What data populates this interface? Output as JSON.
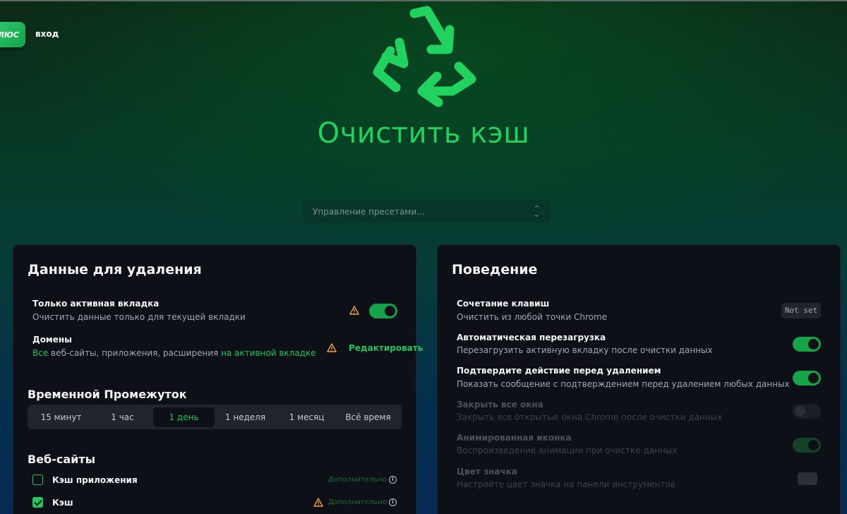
{
  "header": {
    "plus_label": "ЛЮС",
    "login_label": "вход",
    "app_title": "Очистить кэш",
    "preset_placeholder": "Управление пресетами..."
  },
  "data_card": {
    "title": "Данные для удаления",
    "active_tab": {
      "title": "Только активная вкладка",
      "desc": "Очистить данные только для текущей вкладки",
      "enabled": true
    },
    "domains": {
      "title": "Домены",
      "desc_all": "Все",
      "desc_middle": " веб-сайты, приложения, расширения ",
      "desc_scope": "на активной вкладке",
      "edit_label": "Редактировать"
    },
    "time_range": {
      "title": "Временной Промежуток",
      "options": [
        "15 минут",
        "1 час",
        "1 день",
        "1 неделя",
        "1 месяц",
        "Всё время"
      ],
      "selected": "1 день"
    },
    "websites": {
      "title": "Веб-сайты",
      "items": [
        {
          "label": "Кэш приложения",
          "checked": false,
          "more": "Дополнительно"
        },
        {
          "label": "Кэш",
          "checked": true,
          "more": "Дополнительно"
        }
      ]
    }
  },
  "behavior_card": {
    "title": "Поведение",
    "shortcut": {
      "title": "Сочетание клавиш",
      "desc": "Очистить из любой точки Chrome",
      "value": "Not set"
    },
    "auto_reload": {
      "title": "Автоматическая перезагрузка",
      "desc": "Перезагрузить активную вкладку после очистки данных",
      "enabled": true
    },
    "confirm": {
      "title": "Подтвердите действие перед удалением",
      "desc": "Показать сообщение с подтверждением перед удалением любых данных",
      "enabled": true
    },
    "close_windows": {
      "title": "Закрыть все окна",
      "desc": "Закрыть все открытые окна Chrome после очистки данных",
      "enabled": false
    },
    "animated_icon": {
      "title": "Анимированная иконка",
      "desc": "Воспроизведение анимации при очистке данных",
      "enabled": true
    },
    "icon_color": {
      "title": "Цвет значка",
      "desc": "Настройте цвет значка на панели инструментов"
    }
  },
  "colors": {
    "accent": "#22c55e",
    "title_green": "#22d260",
    "warning": "#f0a23a",
    "card_bg": "#0d1016"
  }
}
